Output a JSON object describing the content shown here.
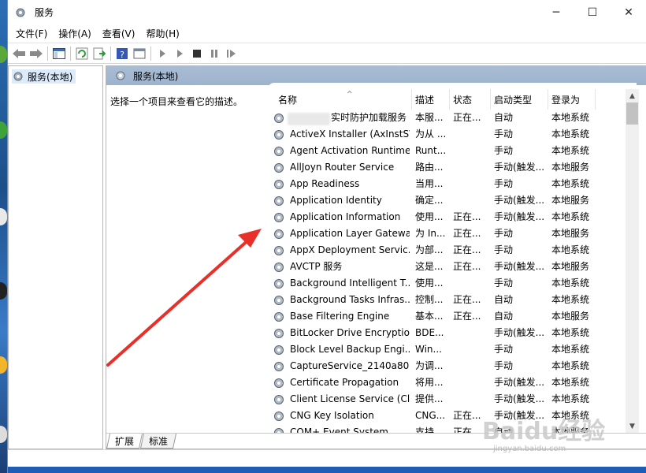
{
  "window": {
    "title": "服务",
    "controls": [
      "─",
      "☐",
      "✕"
    ]
  },
  "menu": [
    "文件(F)",
    "操作(A)",
    "查看(V)",
    "帮助(H)"
  ],
  "tree": {
    "root_label": "服务(本地)"
  },
  "right": {
    "header": "服务(本地)",
    "description": "选择一个项目来查看它的描述。",
    "columns": [
      "名称",
      "描述",
      "状态",
      "启动类型",
      "登录为"
    ]
  },
  "services": [
    {
      "name": "实时防护加载服务",
      "desc": "本服...",
      "status": "正在...",
      "startup": "自动",
      "logon": "本地系统"
    },
    {
      "name": "ActiveX Installer (AxInstSV)",
      "desc": "为从 ...",
      "status": "",
      "startup": "手动",
      "logon": "本地系统"
    },
    {
      "name": "Agent Activation Runtime...",
      "desc": "Runt...",
      "status": "",
      "startup": "手动",
      "logon": "本地系统"
    },
    {
      "name": "AllJoyn Router Service",
      "desc": "路由...",
      "status": "",
      "startup": "手动(触发...",
      "logon": "本地服务"
    },
    {
      "name": "App Readiness",
      "desc": "当用...",
      "status": "",
      "startup": "手动",
      "logon": "本地系统"
    },
    {
      "name": "Application Identity",
      "desc": "确定...",
      "status": "",
      "startup": "手动(触发...",
      "logon": "本地服务"
    },
    {
      "name": "Application Information",
      "desc": "使用...",
      "status": "正在...",
      "startup": "手动(触发...",
      "logon": "本地系统"
    },
    {
      "name": "Application Layer Gatewa...",
      "desc": "为 In...",
      "status": "正在...",
      "startup": "手动",
      "logon": "本地服务"
    },
    {
      "name": "AppX Deployment Servic...",
      "desc": "为部...",
      "status": "正在...",
      "startup": "手动",
      "logon": "本地系统"
    },
    {
      "name": "AVCTP 服务",
      "desc": "这是...",
      "status": "正在...",
      "startup": "手动(触发...",
      "logon": "本地服务"
    },
    {
      "name": "Background Intelligent T...",
      "desc": "使用...",
      "status": "",
      "startup": "手动",
      "logon": "本地系统"
    },
    {
      "name": "Background Tasks Infras...",
      "desc": "控制...",
      "status": "正在...",
      "startup": "自动",
      "logon": "本地系统"
    },
    {
      "name": "Base Filtering Engine",
      "desc": "基本...",
      "status": "正在...",
      "startup": "自动",
      "logon": "本地服务"
    },
    {
      "name": "BitLocker Drive Encryptio...",
      "desc": "BDE...",
      "status": "",
      "startup": "手动(触发...",
      "logon": "本地系统"
    },
    {
      "name": "Block Level Backup Engi...",
      "desc": "Win...",
      "status": "",
      "startup": "手动",
      "logon": "本地系统"
    },
    {
      "name": "CaptureService_2140a80",
      "desc": "为调...",
      "status": "",
      "startup": "手动",
      "logon": "本地系统"
    },
    {
      "name": "Certificate Propagation",
      "desc": "将用...",
      "status": "",
      "startup": "手动(触发...",
      "logon": "本地系统"
    },
    {
      "name": "Client License Service (Cli...",
      "desc": "提供...",
      "status": "",
      "startup": "手动(触发...",
      "logon": "本地系统"
    },
    {
      "name": "CNG Key Isolation",
      "desc": "CNG...",
      "status": "正在...",
      "startup": "手动(触发...",
      "logon": "本地系统"
    },
    {
      "name": "COM+ Event System",
      "desc": "支持...",
      "status": "正在...",
      "startup": "自动",
      "logon": "本地服务"
    }
  ],
  "tabs": [
    "扩展",
    "标准"
  ],
  "watermark": {
    "logo": "Baidu经验",
    "sub": "jingyan.baidu.com"
  },
  "colors": {
    "arrow": "#e8302a",
    "header_bg": "#a9bdd4",
    "selection": "#dcebfc"
  }
}
